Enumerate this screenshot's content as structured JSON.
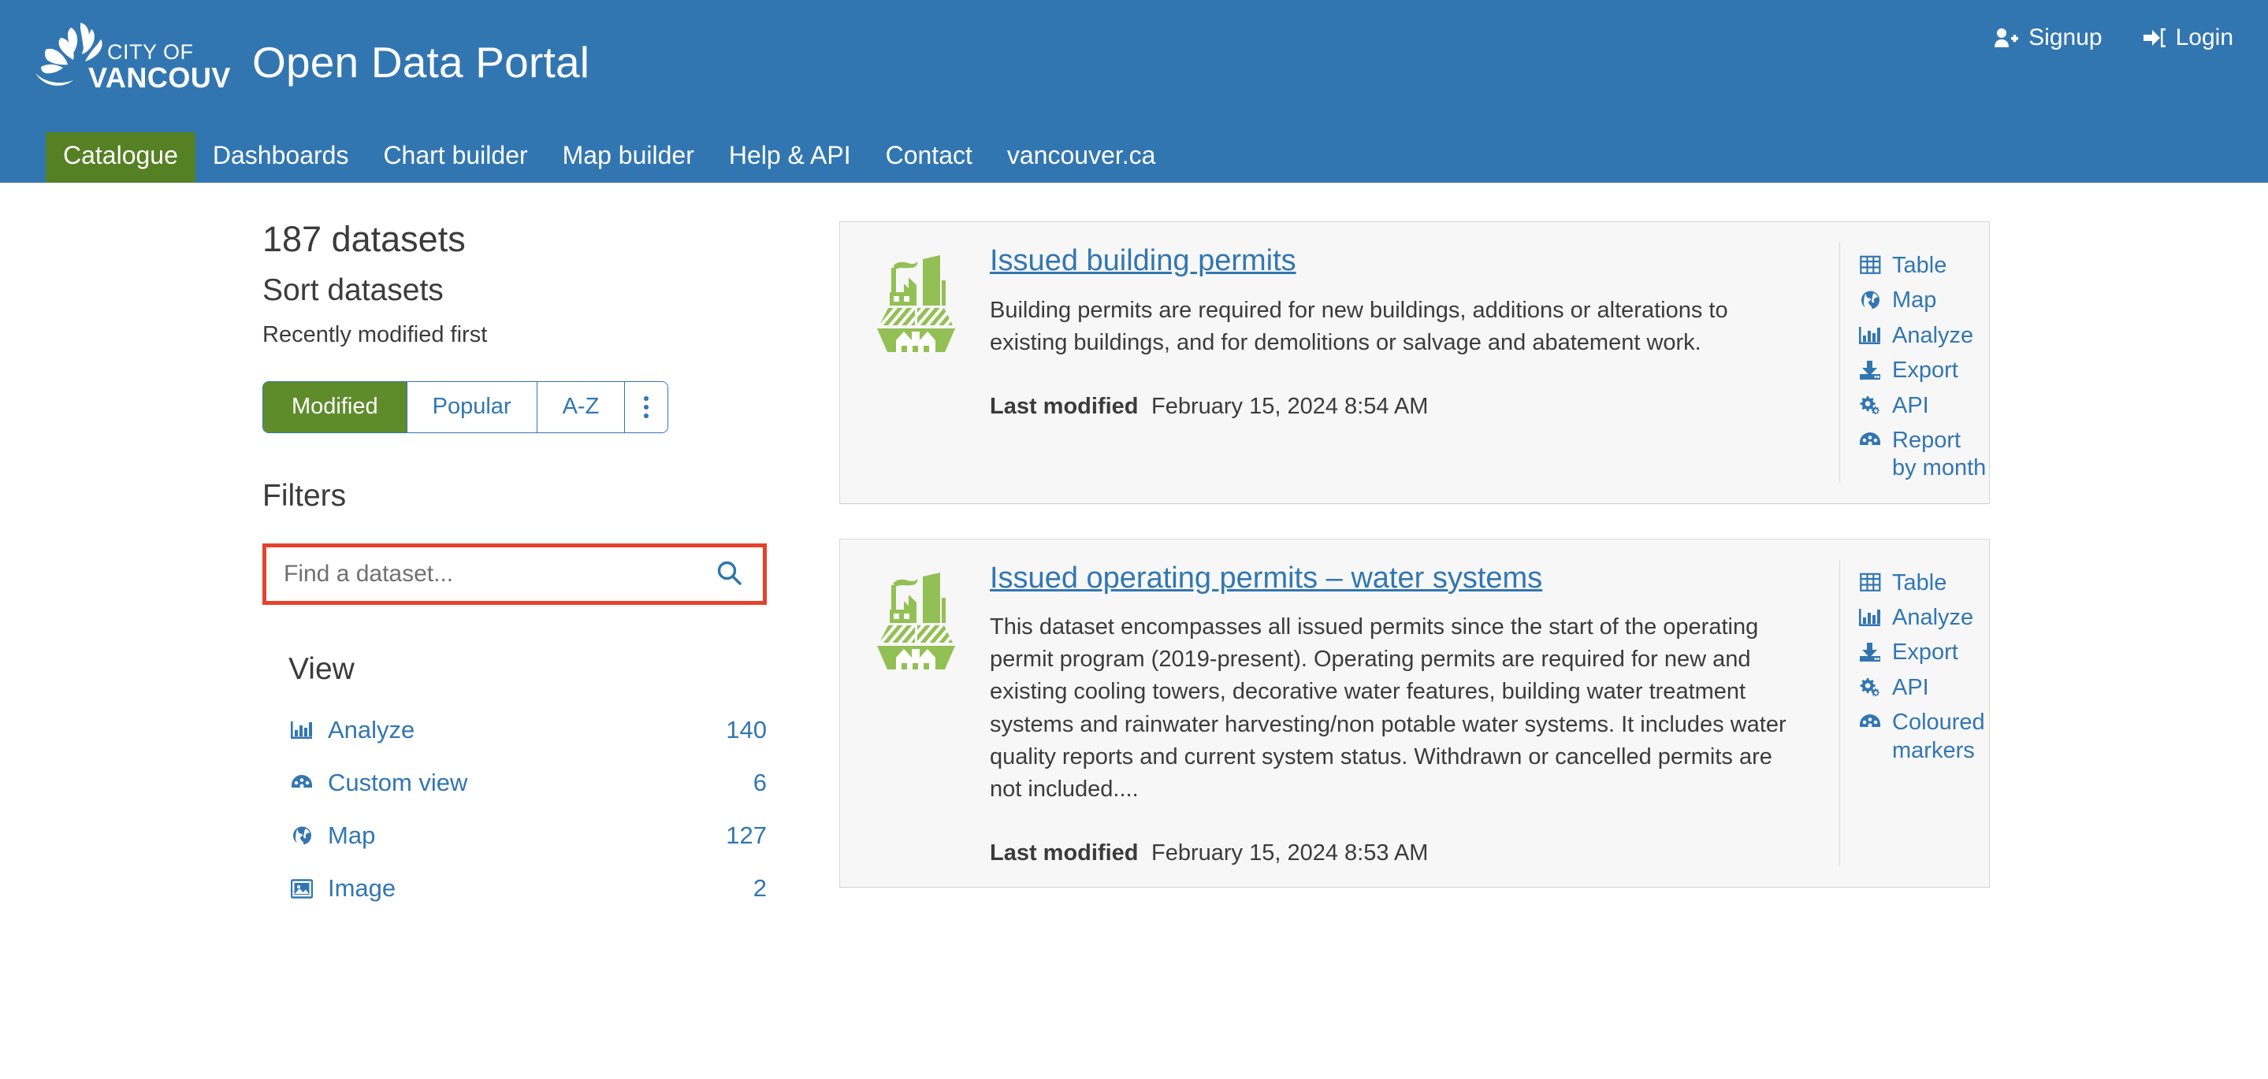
{
  "header": {
    "logo_line1": "CITY OF",
    "logo_line2": "VANCOUVER",
    "title": "Open Data Portal",
    "auth": [
      {
        "label": "Signup",
        "icon": "user-plus-icon"
      },
      {
        "label": "Login",
        "icon": "sign-in-icon"
      }
    ],
    "nav": [
      {
        "label": "Catalogue",
        "active": true
      },
      {
        "label": "Dashboards",
        "active": false
      },
      {
        "label": "Chart builder",
        "active": false
      },
      {
        "label": "Map builder",
        "active": false
      },
      {
        "label": "Help & API",
        "active": false
      },
      {
        "label": "Contact",
        "active": false
      },
      {
        "label": "vancouver.ca",
        "active": false
      }
    ]
  },
  "sidebar": {
    "dataset_count": "187 datasets",
    "sort_heading": "Sort datasets",
    "sort_subtitle": "Recently modified first",
    "sort_buttons": [
      {
        "label": "Modified",
        "selected": true
      },
      {
        "label": "Popular",
        "selected": false
      },
      {
        "label": "A-Z",
        "selected": false
      }
    ],
    "sort_more_icon": "kebab-menu-icon",
    "filters_heading": "Filters",
    "search": {
      "placeholder": "Find a dataset...",
      "value": "",
      "icon": "search-icon"
    },
    "view_heading": "View",
    "facets": [
      {
        "label": "Analyze",
        "count": "140",
        "icon": "bar-chart-icon"
      },
      {
        "label": "Custom view",
        "count": "6",
        "icon": "dashboard-gauge-icon"
      },
      {
        "label": "Map",
        "count": "127",
        "icon": "globe-icon"
      },
      {
        "label": "Image",
        "count": "2",
        "icon": "image-icon"
      }
    ]
  },
  "results": {
    "cards": [
      {
        "icon": "city-buildings-icon",
        "title": "Issued building permits",
        "description": "Building permits are required for new buildings, additions or alterations to existing buildings, and for demolitions or salvage and abatement work.",
        "meta_label": "Last modified",
        "meta_value": "February 15, 2024 8:54 AM",
        "actions": [
          {
            "label": "Table",
            "icon": "table-icon"
          },
          {
            "label": "Map",
            "icon": "globe-icon"
          },
          {
            "label": "Analyze",
            "icon": "bar-chart-icon"
          },
          {
            "label": "Export",
            "icon": "download-icon"
          },
          {
            "label": "API",
            "icon": "gears-icon"
          },
          {
            "label": "Report by month",
            "icon": "dashboard-gauge-icon"
          }
        ]
      },
      {
        "icon": "city-buildings-icon",
        "title": "Issued operating permits – water systems",
        "description": "This dataset encompasses all issued permits since the start of the operating permit program (2019-present). Operating permits are required for new and existing cooling towers, decorative water features, building water treatment systems and rainwater harvesting/non potable water systems. It includes water quality reports and current system status. Withdrawn or cancelled permits are not included....",
        "meta_label": "Last modified",
        "meta_value": "February 15, 2024 8:53 AM",
        "actions": [
          {
            "label": "Table",
            "icon": "table-icon"
          },
          {
            "label": "Analyze",
            "icon": "bar-chart-icon"
          },
          {
            "label": "Export",
            "icon": "download-icon"
          },
          {
            "label": "API",
            "icon": "gears-icon"
          },
          {
            "label": "Coloured markers",
            "icon": "dashboard-gauge-icon"
          }
        ]
      }
    ]
  },
  "colors": {
    "header_blue": "#3276b1",
    "accent_green": "#5e8c2b",
    "nav_active_green": "#558024",
    "link_blue": "#3276b1",
    "highlight_red": "#e5422b",
    "card_bg": "#f7f7f7",
    "icon_green": "#93c054"
  }
}
